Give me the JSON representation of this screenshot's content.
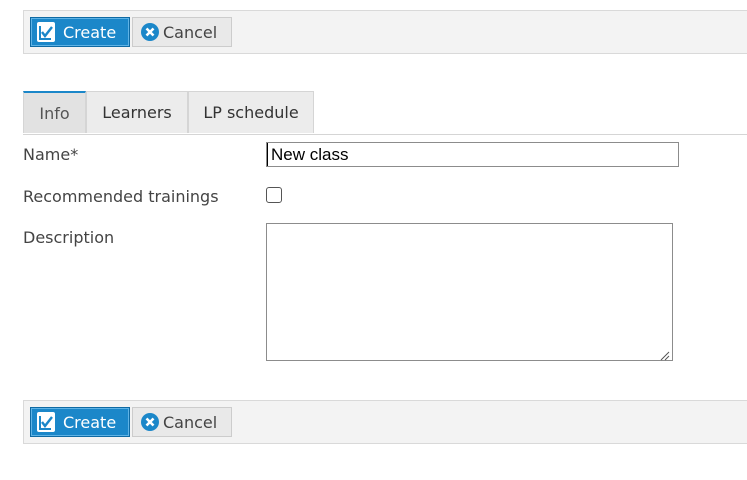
{
  "toolbar_top": {
    "create_label": "Create",
    "cancel_label": "Cancel"
  },
  "tabs": [
    {
      "label": "Info",
      "active": true
    },
    {
      "label": "Learners",
      "active": false
    },
    {
      "label": "LP schedule",
      "active": false
    }
  ],
  "form": {
    "name_label": "Name*",
    "name_value": "New class",
    "recommended_label": "Recommended trainings",
    "recommended_checked": false,
    "description_label": "Description",
    "description_value": ""
  },
  "toolbar_bottom": {
    "create_label": "Create",
    "cancel_label": "Cancel"
  },
  "colors": {
    "accent": "#1b87c9",
    "toolbar_bg": "#f3f3f3",
    "tab_bg": "#ececec"
  },
  "icons": {
    "create": "document-check-icon",
    "cancel": "close-circle-icon"
  }
}
